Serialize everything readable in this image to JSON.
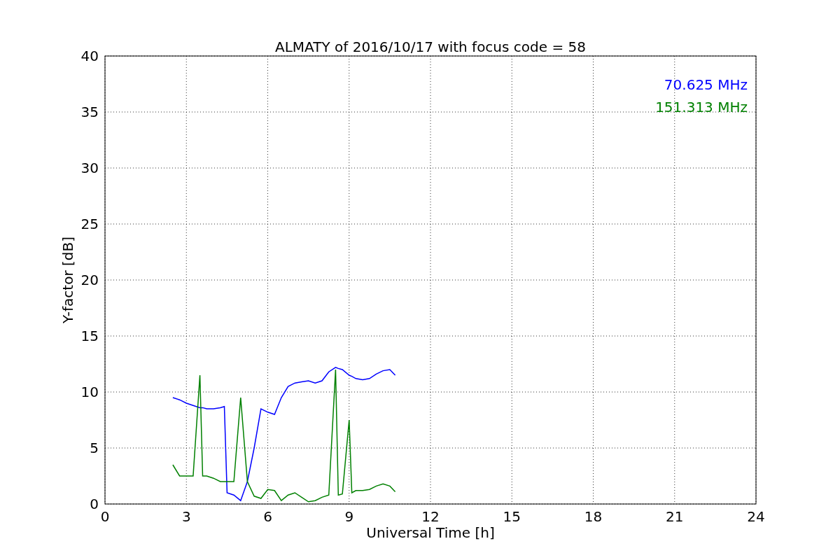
{
  "figure": {
    "chart_data": {
      "type": "line",
      "title": "ALMATY of 2016/10/17 with focus code = 58",
      "xlabel": "Universal Time [h]",
      "ylabel": "Y-factor [dB]",
      "x": [
        2.5,
        2.75,
        3.0,
        3.25,
        3.5,
        3.6,
        3.75,
        4.0,
        4.25,
        4.4,
        4.5,
        4.75,
        5.0,
        5.25,
        5.5,
        5.75,
        6.0,
        6.25,
        6.5,
        6.75,
        7.0,
        7.25,
        7.5,
        7.75,
        8.0,
        8.25,
        8.5,
        8.6,
        8.75,
        9.0,
        9.1,
        9.25,
        9.5,
        9.75,
        10.0,
        10.25,
        10.5,
        10.7
      ],
      "series": [
        {
          "name": "70.625 MHz",
          "color": "#0000ff",
          "values": [
            9.5,
            9.3,
            9.0,
            8.8,
            8.6,
            8.6,
            8.5,
            8.5,
            8.6,
            8.7,
            1.0,
            0.8,
            0.3,
            2.0,
            5.0,
            8.5,
            8.2,
            8.0,
            9.5,
            10.5,
            10.8,
            10.9,
            11.0,
            10.8,
            11.0,
            11.8,
            12.2,
            12.1,
            12.0,
            11.5,
            11.4,
            11.2,
            11.1,
            11.2,
            11.6,
            11.9,
            12.0,
            11.5
          ]
        },
        {
          "name": "151.313 MHz",
          "color": "#008000",
          "values": [
            3.5,
            2.5,
            2.5,
            2.5,
            11.5,
            2.5,
            2.5,
            2.3,
            2.0,
            2.0,
            2.0,
            2.0,
            9.5,
            2.0,
            0.7,
            0.5,
            1.3,
            1.2,
            0.3,
            0.8,
            1.0,
            0.6,
            0.2,
            0.3,
            0.6,
            0.8,
            12.0,
            0.8,
            0.9,
            7.5,
            1.0,
            1.2,
            1.2,
            1.3,
            1.6,
            1.8,
            1.6,
            1.1
          ]
        }
      ],
      "grid": true,
      "xlim": [
        0,
        24
      ],
      "ylim": [
        0,
        40
      ],
      "xticks": [
        0,
        3,
        6,
        9,
        12,
        15,
        18,
        21,
        24
      ],
      "yticks": [
        0,
        5,
        10,
        15,
        20,
        25,
        30,
        35,
        40
      ]
    }
  }
}
